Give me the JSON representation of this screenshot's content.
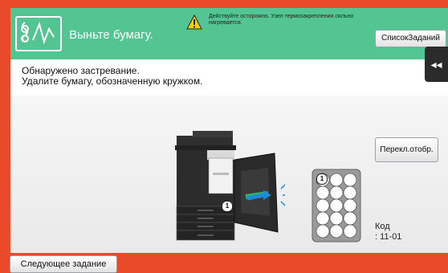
{
  "header": {
    "title": "Выньте бумагу.",
    "warning_icon": "warning-triangle-icon",
    "warning_text": "Действуйте осторожно. Узел термозакрепления сильно нагревается.",
    "job_list_button": "СписокЗаданий"
  },
  "message": {
    "line1": "Обнаружено застревание.",
    "line2": "Удалите бумагу, обозначенную кружком."
  },
  "side_tab": {
    "icon": "double-chevron-left-icon",
    "label": "◂◂"
  },
  "view_switch_button": "Перекл.отобр.",
  "code": {
    "label": "Код",
    "value": ": 11-01"
  },
  "diagram": {
    "printer_marker": "1",
    "tray_marker": "1"
  },
  "bottom": {
    "next_job_button": "Следующее задание"
  },
  "colors": {
    "frame": "#e84a2a",
    "header": "#52c592"
  }
}
